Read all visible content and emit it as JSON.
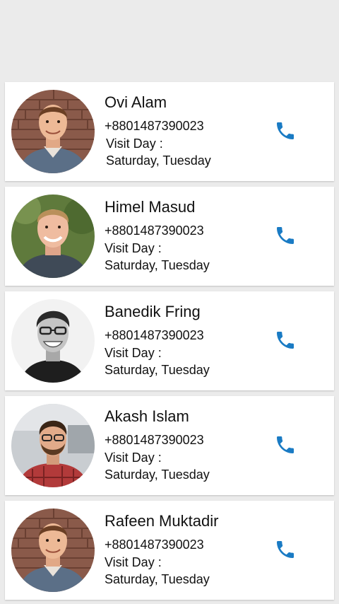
{
  "contacts": [
    {
      "name": "Ovi Alam",
      "phone": "+8801487390023",
      "visit_label": "Visit Day :",
      "visit_days": "Saturday, Tuesday",
      "avatar": "man-in-plaid-shirt-brick-wall-photo"
    },
    {
      "name": "Himel Masud",
      "phone": "+8801487390023",
      "visit_label": "Visit Day :",
      "visit_days": "Saturday, Tuesday",
      "avatar": "smiling-man-outdoors-photo"
    },
    {
      "name": "Banedik Fring",
      "phone": "+8801487390023",
      "visit_label": "Visit Day :",
      "visit_days": "Saturday, Tuesday",
      "avatar": "man-with-glasses-black-and-white-photo"
    },
    {
      "name": "Akash Islam",
      "phone": "+8801487390023",
      "visit_label": "Visit Day :",
      "visit_days": "Saturday, Tuesday",
      "avatar": "bearded-man-with-glasses-photo"
    },
    {
      "name": "Rafeen Muktadir",
      "phone": "+8801487390023",
      "visit_label": "Visit Day :",
      "visit_days": "Saturday, Tuesday",
      "avatar": "man-in-plaid-shirt-brick-wall-photo"
    }
  ],
  "icons": {
    "call": "phone-icon"
  },
  "colors": {
    "background": "#ebebeb",
    "card": "#ffffff",
    "call_icon": "#1a7bc4",
    "text": "#111111"
  }
}
